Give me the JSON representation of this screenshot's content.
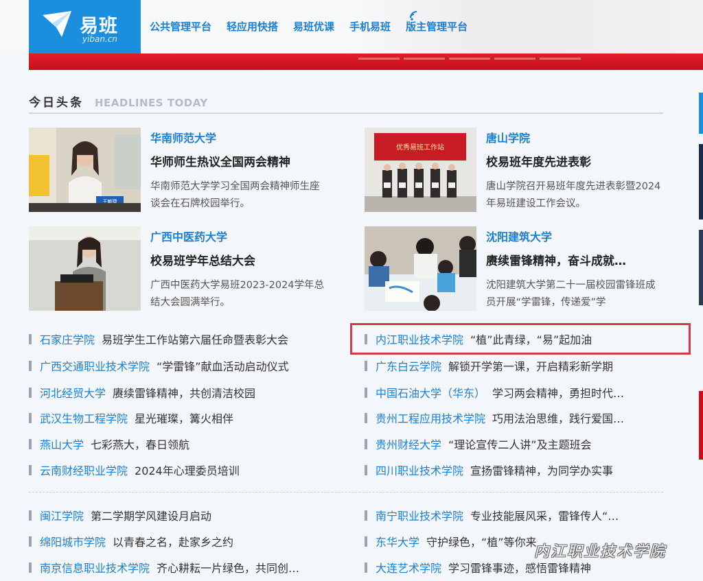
{
  "header": {
    "logo_text": "易班",
    "logo_sub": "yiban.cn",
    "nav": [
      "公共管理平台",
      "轻应用快搭",
      "易班优课",
      "手机易班",
      "版主管理平台"
    ]
  },
  "section": {
    "title_cn": "今日头条",
    "title_en": "HEADLINES TODAY"
  },
  "features": [
    {
      "school": "华南师范大学",
      "headline": "华师师生热议全国两会精神",
      "summary": "华南师范大学学习全国两会精神师生座谈会在石牌校园举行。",
      "thumb_caption": "王敏捷"
    },
    {
      "school": "唐山学院",
      "headline": "校易班年度先进表彰",
      "summary": "唐山学院召开易班年度先进表彰暨2024年易班建设工作会议。",
      "thumb_caption": "优秀易班工作站"
    },
    {
      "school": "广西中医药大学",
      "headline": "校易班学年总结大会",
      "summary": "广西中医药大学易班2023-2024学年总结大会圆满举行。"
    },
    {
      "school": "沈阳建筑大学",
      "headline": "赓续雷锋精神，奋斗成就…",
      "summary": "沈阳建筑大学第二十一届校园雷锋班成员开展“学雷锋，传递爱”学"
    }
  ],
  "list_left": [
    {
      "school": "石家庄学院",
      "title": "易班学生工作站第六届任命暨表彰大会"
    },
    {
      "school": "广西交通职业技术学院",
      "title": "“学雷锋”献血活动启动仪式"
    },
    {
      "school": "河北经贸大学",
      "title": "赓续雷锋精神，共创清洁校园"
    },
    {
      "school": "武汉生物工程学院",
      "title": "星光璀璨，篝火相伴"
    },
    {
      "school": "燕山大学",
      "title": "七彩燕大，春日领航"
    },
    {
      "school": "云南财经职业学院",
      "title": "2024年心理委员培训"
    },
    {
      "school": "闽江学院",
      "title": "第二学期学风建设月启动"
    },
    {
      "school": "绵阳城市学院",
      "title": "以青春之名，赴家乡之约"
    },
    {
      "school": "南京信息职业技术学院",
      "title": "齐心耕耘一片绿色，共同创…"
    }
  ],
  "list_right": [
    {
      "school": "内江职业技术学院",
      "title": "“植”此青绿，“易”起加油"
    },
    {
      "school": "广东白云学院",
      "title": "解锁开学第一课，开启精彩新学期"
    },
    {
      "school": "中国石油大学（华东）",
      "title": "学习两会精神，勇担时代…"
    },
    {
      "school": "贵州工程应用技术学院",
      "title": "巧用法治思维，践行爱国…"
    },
    {
      "school": "贵州财经大学",
      "title": "“理论宣传二人讲”及主题班会"
    },
    {
      "school": "四川职业技术学院",
      "title": "宣扬雷锋精神，为同学办实事"
    },
    {
      "school": "南宁职业技术学院",
      "title": "专业技能展风采，雷锋传人“…"
    },
    {
      "school": "东华大学",
      "title": "守护绿色，“植”等你来"
    },
    {
      "school": "大连艺术学院",
      "title": "学习雷锋事迹，感悟雷锋精神"
    }
  ],
  "watermark": "内江职业技术学院",
  "colors": {
    "brand_blue": "#1b8fdd",
    "link_blue": "#1b7fd1",
    "red_bar": "#d7141f",
    "highlight": "#d9374a"
  }
}
